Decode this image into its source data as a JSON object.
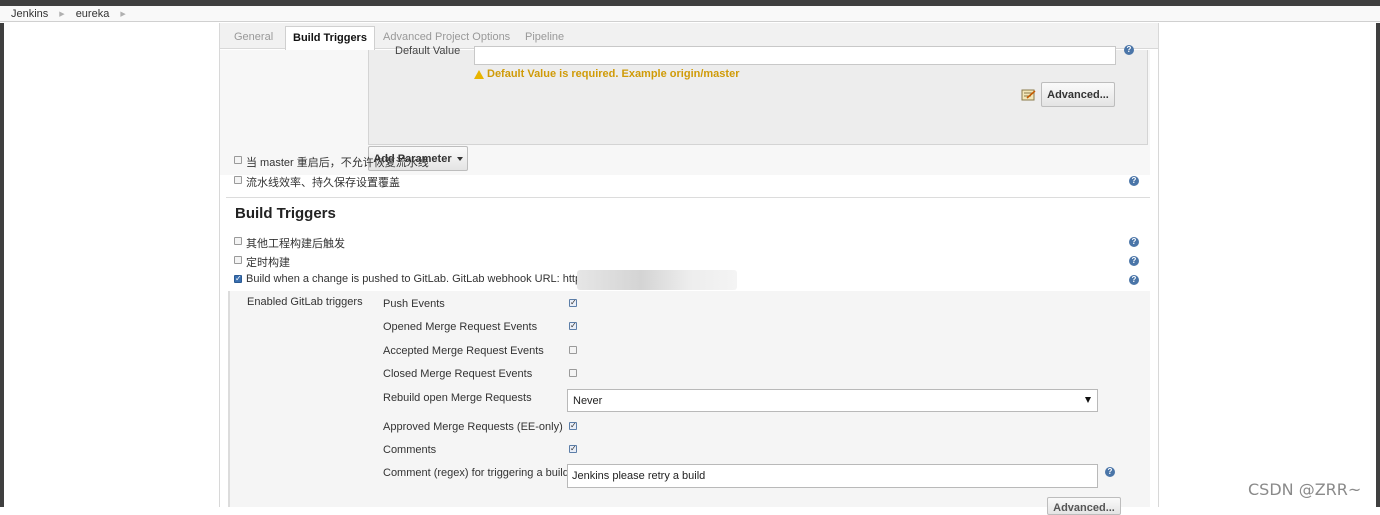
{
  "breadcrumbs": [
    "Jenkins",
    "eureka"
  ],
  "tabs": [
    {
      "label": "General",
      "active": false
    },
    {
      "label": "Build Triggers",
      "active": true
    },
    {
      "label": "Advanced Project Options",
      "active": false
    },
    {
      "label": "Pipeline",
      "active": false
    }
  ],
  "parameter": {
    "default_label": "Default Value",
    "default_value": "",
    "warning": "Default Value is required. Example origin/master",
    "advanced_label": "Advanced...",
    "add_parameter_label": "Add Parameter"
  },
  "options": [
    {
      "label": "当 master 重启后，不允许恢复流水线",
      "checked": false
    },
    {
      "label": "流水线效率、持久保存设置覆盖",
      "checked": false
    }
  ],
  "build_triggers": {
    "title": "Build Triggers",
    "items": [
      {
        "label": "其他工程构建后触发",
        "checked": false
      },
      {
        "label": "定时构建",
        "checked": false
      },
      {
        "label": "Build when a change is pushed to GitLab. GitLab webhook URL: http://1",
        "checked": true
      }
    ],
    "gitlab": {
      "section_label": "Enabled GitLab triggers",
      "events": [
        {
          "label": "Push Events",
          "checked": true
        },
        {
          "label": "Opened Merge Request Events",
          "checked": true
        },
        {
          "label": "Accepted Merge Request Events",
          "checked": false
        },
        {
          "label": "Closed Merge Request Events",
          "checked": false
        }
      ],
      "rebuild_label": "Rebuild open Merge Requests",
      "rebuild_value": "Never",
      "approved_label": "Approved Merge Requests (EE-only)",
      "approved_checked": true,
      "comments_label": "Comments",
      "comments_checked": true,
      "comment_regex_label": "Comment (regex) for triggering a build",
      "comment_regex_value": "Jenkins please retry a build",
      "advanced_label": "Advanced..."
    }
  },
  "watermark": "CSDN @ZRR~",
  "colors": {
    "help_icon": "#4a75a8",
    "warning": "#d09b08",
    "header": "#3f3f3f"
  }
}
